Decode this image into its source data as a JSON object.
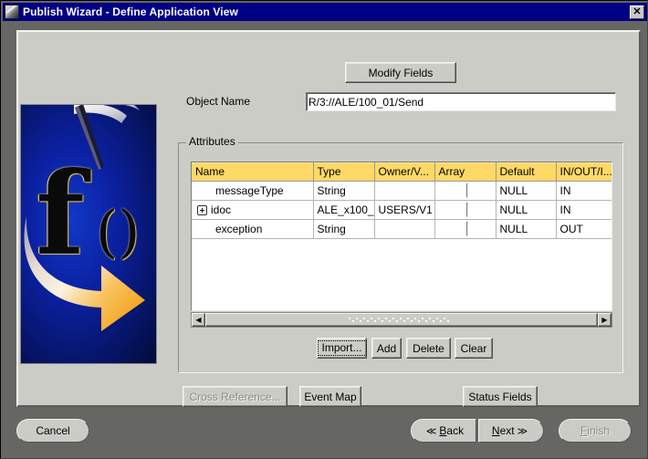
{
  "window": {
    "title": "Publish Wizard - Define Application View",
    "icon": "wand-document-icon",
    "close_label": "✕"
  },
  "form": {
    "modify_fields_label": "Modify Fields",
    "object_name_label": "Object Name",
    "object_name_value": "R/3://ALE/100_01/Send"
  },
  "attributes": {
    "group_label": "Attributes",
    "columns": [
      "Name",
      "Type",
      "Owner/V...",
      "Array",
      "Default",
      "IN/OUT/I..."
    ],
    "rows": [
      {
        "expandable": false,
        "name": "messageType",
        "type": "String",
        "owner": "",
        "array_checked": false,
        "default": "NULL",
        "direction": "IN"
      },
      {
        "expandable": true,
        "name": "idoc",
        "type": "ALE_x100_",
        "owner": "USERS/V1",
        "array_checked": false,
        "default": "NULL",
        "direction": "IN"
      },
      {
        "expandable": false,
        "name": "exception",
        "type": "String",
        "owner": "",
        "array_checked": false,
        "default": "NULL",
        "direction": "OUT"
      }
    ],
    "scrollbar": {
      "left_arrow": "◀",
      "right_arrow": "▶"
    },
    "buttons": {
      "import": "Import...",
      "add": "Add",
      "delete": "Delete",
      "clear": "Clear"
    }
  },
  "extra_buttons": {
    "cross_reference": "Cross Reference...",
    "event_map": "Event Map",
    "status_fields": "Status Fields"
  },
  "wizard_nav": {
    "cancel": "Cancel",
    "back_prefix": "≪",
    "back_mnemonic": "B",
    "back_rest": "ack",
    "next_mnemonic": "N",
    "next_rest": "ext",
    "next_suffix": "≫",
    "finish_mnemonic": "F",
    "finish_rest": "inish"
  },
  "colors": {
    "titlebar": "#000083",
    "face": "#ccccc6",
    "frame": "#666663",
    "header_yellow": "#ffd966",
    "logo_blue": "#0b20a0",
    "logo_orange": "#f5a01e"
  }
}
